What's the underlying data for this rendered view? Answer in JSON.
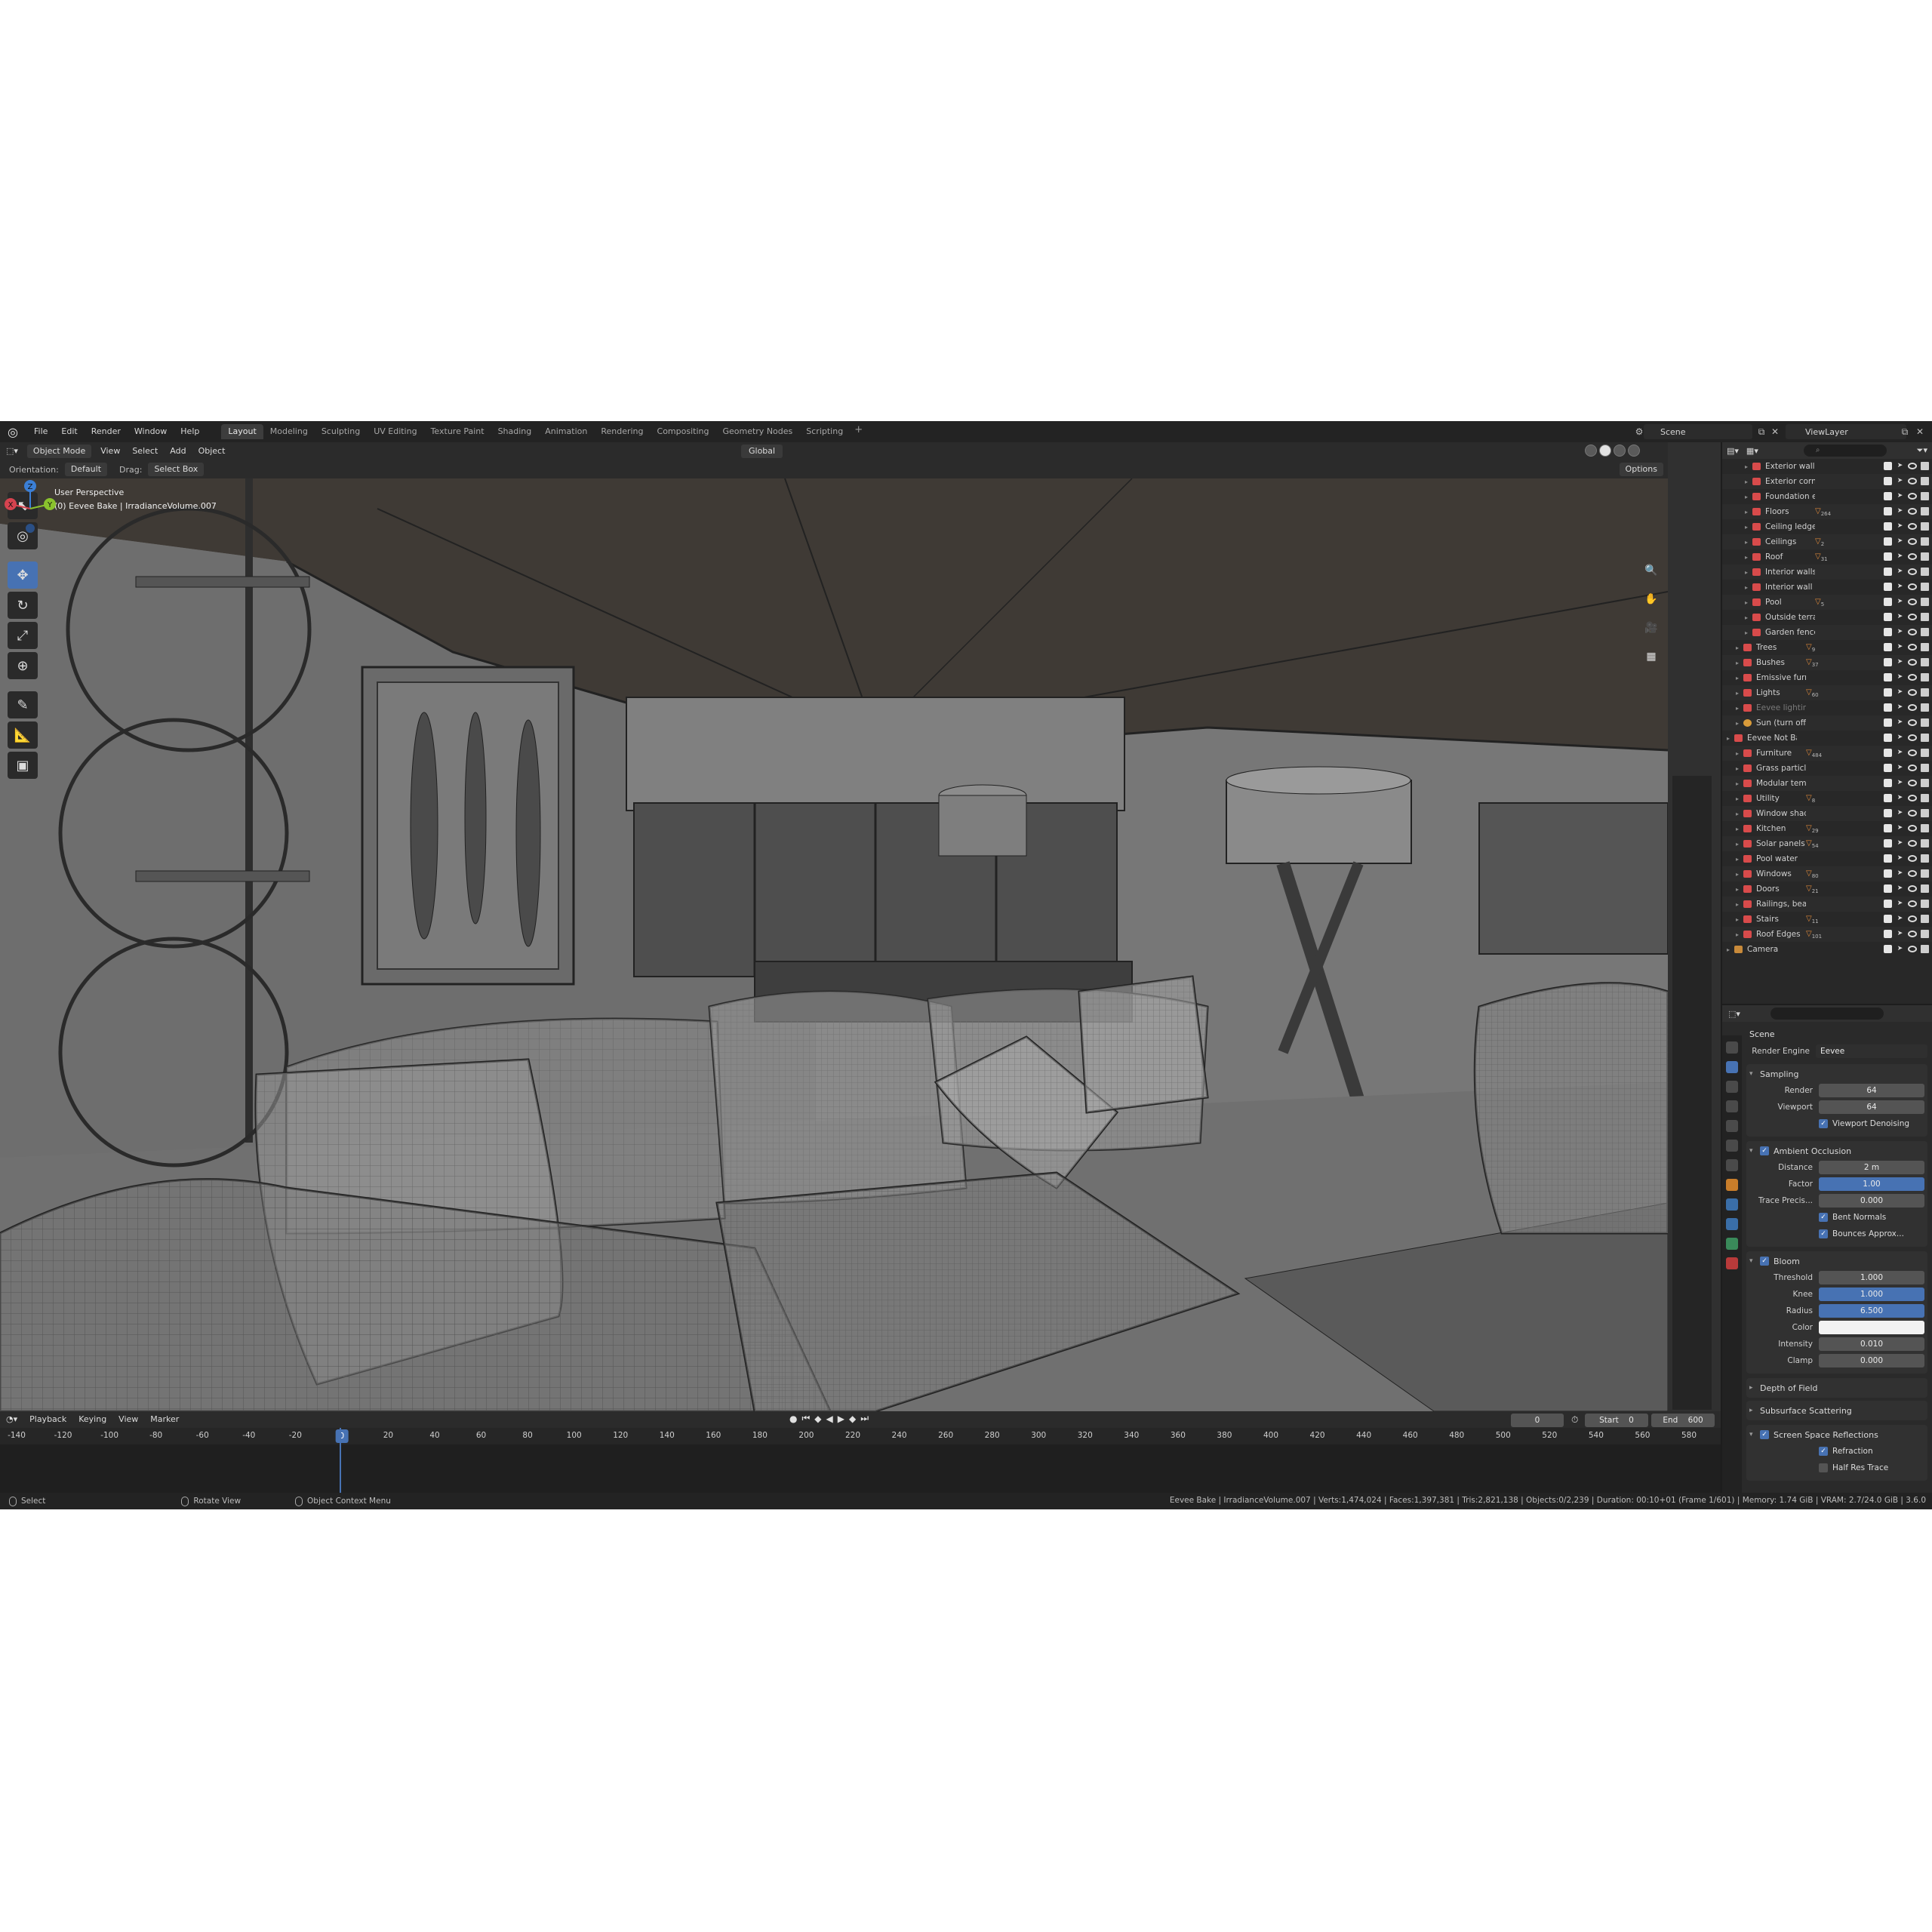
{
  "menu": [
    "File",
    "Edit",
    "Render",
    "Window",
    "Help"
  ],
  "workspaces": [
    "Layout",
    "Modeling",
    "Sculpting",
    "UV Editing",
    "Texture Paint",
    "Shading",
    "Animation",
    "Rendering",
    "Compositing",
    "Geometry Nodes",
    "Scripting"
  ],
  "active_workspace": "Layout",
  "add_tab": "+",
  "scene_name": "Scene",
  "view_layer": "ViewLayer",
  "viewport_header": {
    "mode": "Object Mode",
    "view": "View",
    "select": "Select",
    "add": "Add",
    "object": "Object",
    "transform_orientation": "Global",
    "options": "Options"
  },
  "tool_settings": {
    "orientation_label": "Orientation:",
    "orientation_value": "Default",
    "drag_label": "Drag:",
    "drag_value": "Select Box"
  },
  "viewport_info": {
    "line1": "User Perspective",
    "line2": "(0) Eevee Bake | IrradianceVolume.007"
  },
  "gizmo": {
    "x": "X",
    "y": "Y",
    "z": "Z"
  },
  "outliner": {
    "search_placeholder": "",
    "rows": [
      {
        "name": "Exterior walls",
        "indent": 2,
        "badge": "",
        "dim": false
      },
      {
        "name": "Exterior corner p",
        "indent": 2,
        "badge": "",
        "dim": false
      },
      {
        "name": "Foundation exter",
        "indent": 2,
        "badge": "",
        "dim": false
      },
      {
        "name": "Floors",
        "indent": 2,
        "badge": "264",
        "dim": false
      },
      {
        "name": "Ceiling ledges",
        "indent": 2,
        "badge": "",
        "dim": false
      },
      {
        "name": "Ceilings",
        "indent": 2,
        "badge": "2",
        "dim": false
      },
      {
        "name": "Roof",
        "indent": 2,
        "badge": "31",
        "dim": false
      },
      {
        "name": "Interior walls",
        "indent": 2,
        "badge": "",
        "dim": false
      },
      {
        "name": "Interior wall corn",
        "indent": 2,
        "badge": "",
        "dim": false
      },
      {
        "name": "Pool",
        "indent": 2,
        "badge": "5",
        "dim": false
      },
      {
        "name": "Outside terrain",
        "indent": 2,
        "badge": "",
        "dim": false
      },
      {
        "name": "Garden fences",
        "indent": 2,
        "badge": "",
        "dim": false
      },
      {
        "name": "Trees",
        "indent": 1,
        "badge": "9",
        "dim": false
      },
      {
        "name": "Bushes",
        "indent": 1,
        "badge": "37",
        "dim": false
      },
      {
        "name": "Emissive furniture",
        "indent": 1,
        "badge": "",
        "dim": false
      },
      {
        "name": "Lights",
        "indent": 1,
        "badge": "60",
        "dim": false
      },
      {
        "name": "Eevee lighting",
        "indent": 1,
        "badge": "",
        "dim": true
      },
      {
        "name": "Sun (turn off for cycle",
        "indent": 1,
        "badge": "",
        "dim": false,
        "light": true
      },
      {
        "name": "Eevee Not Bake",
        "indent": 0,
        "badge": "",
        "dim": false
      },
      {
        "name": "Furniture",
        "indent": 1,
        "badge": "484",
        "dim": false
      },
      {
        "name": "Grass particles",
        "indent": 1,
        "badge": "",
        "dim": false
      },
      {
        "name": "Modular template",
        "indent": 1,
        "badge": "",
        "dim": false
      },
      {
        "name": "Utility",
        "indent": 1,
        "badge": "8",
        "dim": false
      },
      {
        "name": "Window shades",
        "indent": 1,
        "badge": "",
        "dim": false
      },
      {
        "name": "Kitchen",
        "indent": 1,
        "badge": "29",
        "dim": false
      },
      {
        "name": "Solar panels",
        "indent": 1,
        "badge": "54",
        "dim": false
      },
      {
        "name": "Pool water",
        "indent": 1,
        "badge": "",
        "dim": false
      },
      {
        "name": "Windows",
        "indent": 1,
        "badge": "80",
        "dim": false
      },
      {
        "name": "Doors",
        "indent": 1,
        "badge": "21",
        "dim": false
      },
      {
        "name": "Railings, beams and",
        "indent": 1,
        "badge": "",
        "dim": false
      },
      {
        "name": "Stairs",
        "indent": 1,
        "badge": "11",
        "dim": false
      },
      {
        "name": "Roof Edges",
        "indent": 1,
        "badge": "101",
        "dim": false
      },
      {
        "name": "Camera",
        "indent": 0,
        "badge": "",
        "dim": false,
        "camera": true
      }
    ]
  },
  "properties": {
    "context": "Scene",
    "render_engine_label": "Render Engine",
    "render_engine": "Eevee",
    "sampling": {
      "title": "Sampling",
      "render_label": "Render",
      "render": "64",
      "viewport_label": "Viewport",
      "viewport": "64",
      "denoise": "Viewport Denoising"
    },
    "ao": {
      "title": "Ambient Occlusion",
      "distance_label": "Distance",
      "distance": "2 m",
      "factor_label": "Factor",
      "factor": "1.00",
      "trace_label": "Trace Precis...",
      "trace": "0.000",
      "bent_normals": "Bent Normals",
      "bounces": "Bounces Approx..."
    },
    "bloom": {
      "title": "Bloom",
      "threshold_label": "Threshold",
      "threshold": "1.000",
      "knee_label": "Knee",
      "knee": "1.000",
      "radius_label": "Radius",
      "radius": "6.500",
      "color_label": "Color",
      "intensity_label": "Intensity",
      "intensity": "0.010",
      "clamp_label": "Clamp",
      "clamp": "0.000"
    },
    "dof": "Depth of Field",
    "sss": "Subsurface Scattering",
    "ssr": {
      "title": "Screen Space Reflections",
      "refraction": "Refraction",
      "half_res": "Half Res Trace"
    }
  },
  "timeline": {
    "playback": "Playback",
    "keying": "Keying",
    "view": "View",
    "marker": "Marker",
    "current_frame": "0",
    "start_label": "Start",
    "start": "0",
    "end_label": "End",
    "end": "600",
    "ticks": [
      "-140",
      "-120",
      "-100",
      "-80",
      "-60",
      "-40",
      "-20",
      "0",
      "20",
      "40",
      "60",
      "80",
      "100",
      "120",
      "140",
      "160",
      "180",
      "200",
      "220",
      "240",
      "260",
      "280",
      "300",
      "320",
      "340",
      "360",
      "380",
      "400",
      "420",
      "440",
      "460",
      "480",
      "500",
      "520",
      "540",
      "560",
      "580"
    ]
  },
  "status": {
    "select": "Select",
    "rotate": "Rotate View",
    "context": "Object Context Menu",
    "stats": "Eevee Bake | IrradianceVolume.007 | Verts:1,474,024 | Faces:1,397,381 | Tris:2,821,138 | Objects:0/2,239 | Duration: 00:10+01 (Frame 1/601) | Memory: 1.74 GiB | VRAM: 2.7/24.0 GiB | 3.6.0"
  }
}
